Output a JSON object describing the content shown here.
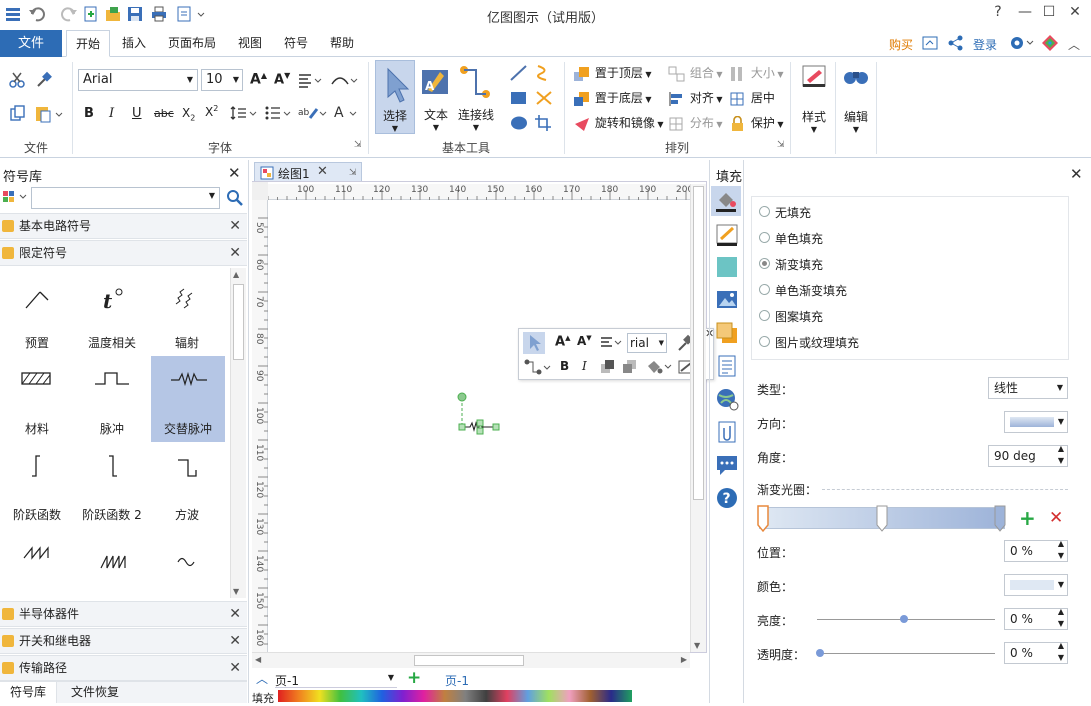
{
  "app": {
    "title": "亿图图示（试用版）"
  },
  "ribbon_tabs": {
    "file": "文件",
    "items": [
      "开始",
      "插入",
      "页面布局",
      "视图",
      "符号",
      "帮助"
    ]
  },
  "topright": {
    "buy": "购买",
    "login": "登录"
  },
  "ribbon": {
    "groups": {
      "file": "文件",
      "font": "字体",
      "basic_tools": "基本工具",
      "arrange": "排列"
    },
    "font_name": "Arial",
    "font_size": "10",
    "tools": {
      "select": "选择",
      "text": "文本",
      "connector": "连接线"
    },
    "arrange": {
      "bring_front": "置于顶层",
      "send_back": "置于底层",
      "rotate_mirror": "旋转和镜像",
      "group": "组合",
      "align": "对齐",
      "distribute": "分布",
      "size": "大小",
      "center": "居中",
      "protect": "保护"
    },
    "style": "样式",
    "edit": "编辑"
  },
  "left_panel": {
    "title": "符号库",
    "categories_top": [
      "基本电路符号",
      "限定符号"
    ],
    "symbols": [
      "预置",
      "温度相关",
      "辐射",
      "材料",
      "脉冲",
      "交替脉冲",
      "阶跃函数",
      "阶跃函数 2",
      "方波"
    ],
    "categories_bottom": [
      "半导体器件",
      "开关和继电器",
      "传输路径"
    ],
    "bottom_tabs": [
      "符号库",
      "文件恢复"
    ]
  },
  "document": {
    "tab": "绘图1",
    "page": "页-1",
    "page_tab": "页-1",
    "fill_label": "填充"
  },
  "ruler": {
    "h": [
      "100",
      "110",
      "120",
      "130",
      "140",
      "150",
      "160",
      "170",
      "180",
      "190",
      "200"
    ],
    "v": [
      "50",
      "60",
      "70",
      "80",
      "90",
      "100",
      "110",
      "120",
      "130",
      "140",
      "150",
      "160"
    ]
  },
  "mini_toolbar": {
    "font": "rial"
  },
  "fill_panel": {
    "title": "填充",
    "options": [
      "无填充",
      "单色填充",
      "渐变填充",
      "单色渐变填充",
      "图案填充",
      "图片或纹理填充"
    ],
    "selected_index": 2,
    "type_label": "类型：",
    "type_value": "线性",
    "direction_label": "方向：",
    "angle_label": "角度：",
    "angle_value": "90 deg",
    "aperture_label": "渐变光圈：",
    "position_label": "位置：",
    "position_value": "0 %",
    "color_label": "颜色：",
    "brightness_label": "亮度：",
    "brightness_value": "0 %",
    "transparency_label": "透明度：",
    "transparency_value": "0 %"
  },
  "colors": {
    "accent": "#2d6cb5",
    "selection": "#b5c6e5",
    "gradient_start": "#dfe8f3",
    "gradient_end": "#9db3d9"
  }
}
